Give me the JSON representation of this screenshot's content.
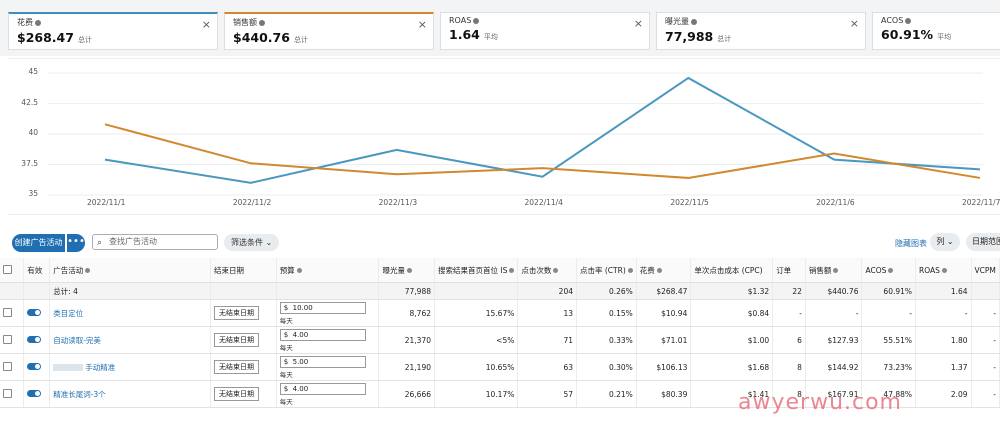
{
  "metrics": [
    {
      "label": "花费",
      "value": "$268.47",
      "sub": "总计",
      "closable": true,
      "accent": "#3f8ebd"
    },
    {
      "label": "销售额",
      "value": "$440.76",
      "sub": "总计",
      "closable": true,
      "accent": "#d1892f"
    },
    {
      "label": "ROAS",
      "value": "1.64",
      "sub": "平均",
      "closable": true
    },
    {
      "label": "曝光量",
      "value": "77,988",
      "sub": "总计",
      "closable": true
    },
    {
      "label": "ACOS",
      "value": "60.91%",
      "sub": "平均",
      "closable": false
    }
  ],
  "close_glyph": "×",
  "chart_data": {
    "type": "line",
    "x": [
      "2022/11/1",
      "2022/11/2",
      "2022/11/3",
      "2022/11/4",
      "2022/11/5",
      "2022/11/6",
      "2022/11/7"
    ],
    "yticks": [
      "45",
      "42.5",
      "40",
      "37.5",
      "35"
    ],
    "ylim": [
      35,
      45.5
    ],
    "series": [
      {
        "color": "#4a97bf",
        "values": [
          37.9,
          36.0,
          38.7,
          36.5,
          44.6,
          37.9,
          37.1
        ]
      },
      {
        "color": "#d1892f",
        "values": [
          40.8,
          37.6,
          36.7,
          37.2,
          36.4,
          38.4,
          36.4
        ]
      }
    ]
  },
  "toolbar": {
    "create": "创建广告活动",
    "more": "•••",
    "search_placeholder": "查找广告活动",
    "filter": "筛选条件 ⌄",
    "hide_chart": "隐藏图表",
    "columns": "列 ⌄",
    "date_range": "日期范围"
  },
  "table": {
    "headers": [
      "",
      "有效",
      "广告活动",
      "结束日期",
      "预算",
      "曝光量",
      "搜索结果首页首位 IS",
      "点击次数",
      "点击率 (CTR)",
      "花费",
      "单次点击成本 (CPC)",
      "订单",
      "销售额",
      "ACOS",
      "ROAS",
      "VCPM"
    ],
    "total": {
      "label": "总计: 4",
      "impr": "77,988",
      "is": "",
      "clicks": "204",
      "ctr": "0.26%",
      "spend": "$268.47",
      "cpc": "$1.32",
      "orders": "22",
      "sales": "$440.76",
      "acos": "60.91%",
      "roas": "1.64",
      "vcpm": ""
    },
    "rows": [
      {
        "name": "类目定位",
        "end": "无结束日期",
        "currency": "$",
        "budget": "10.00",
        "daily": "每天",
        "impr": "8,762",
        "is": "15.67%",
        "clicks": "13",
        "ctr": "0.15%",
        "spend": "$10.94",
        "cpc": "$0.84",
        "orders": "-",
        "sales": "-",
        "acos": "-",
        "roas": "-",
        "vcpm": "-"
      },
      {
        "name": "自动读取-完美",
        "end": "无结束日期",
        "currency": "$",
        "budget": "4.00",
        "daily": "每天",
        "impr": "21,370",
        "is": "<5%",
        "clicks": "71",
        "ctr": "0.33%",
        "spend": "$71.01",
        "cpc": "$1.00",
        "orders": "6",
        "sales": "$127.93",
        "acos": "55.51%",
        "roas": "1.80",
        "vcpm": "-"
      },
      {
        "name": "手动精准",
        "end": "无结束日期",
        "currency": "$",
        "budget": "5.00",
        "daily": "每天",
        "impr": "21,190",
        "is": "10.65%",
        "clicks": "63",
        "ctr": "0.30%",
        "spend": "$106.13",
        "cpc": "$1.68",
        "orders": "8",
        "sales": "$144.92",
        "acos": "73.23%",
        "roas": "1.37",
        "vcpm": "-"
      },
      {
        "name": "精准长尾词-3个",
        "end": "无结束日期",
        "currency": "$",
        "budget": "4.00",
        "daily": "每天",
        "impr": "26,666",
        "is": "10.17%",
        "clicks": "57",
        "ctr": "0.21%",
        "spend": "$80.39",
        "cpc": "$1.41",
        "orders": "8",
        "sales": "$167.91",
        "acos": "47.88%",
        "roas": "2.09",
        "vcpm": "-"
      }
    ]
  },
  "watermark": "awyerwu.com"
}
